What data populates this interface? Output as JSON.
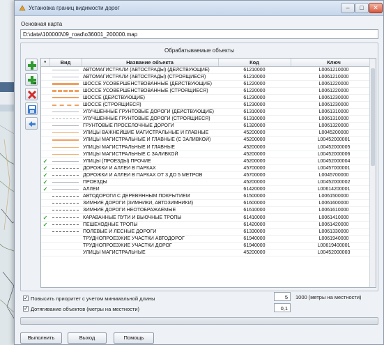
{
  "window": {
    "title": "Установка границ видимости дорог",
    "minimize_glyph": "–",
    "maximize_glyph": "□",
    "close_glyph": "✕"
  },
  "map": {
    "label": "Основная карта",
    "path": "D:\\data\\100000\\09_road\\o36001_200000.map"
  },
  "objects_group": {
    "title": "Обрабатываемые объекты"
  },
  "toolbar": {
    "icons": [
      "add-icon",
      "add-all-icon",
      "delete-icon",
      "save-icon",
      "back-icon"
    ]
  },
  "table": {
    "headers": {
      "check": "*",
      "sample": "Вид",
      "name": "Название объекта",
      "code": "Код",
      "key": "Ключ"
    },
    "rows": [
      {
        "checked": "",
        "style": {
          "color": "#b0b6bd",
          "dash": "solid",
          "width": 1
        },
        "name": "АВТОМАГИСТРАЛИ (АВТОСТРАДЫ) (ДЕЙСТВУЮЩИЕ)",
        "code": "61210000",
        "key": "L0061210000"
      },
      {
        "checked": "",
        "style": {
          "color": "#b0b6bd",
          "dash": "solid",
          "width": 1
        },
        "name": "АВТОМАГИСТРАЛИ (АВТОСТРАДЫ) (СТРОЯЩИЕСЯ)",
        "code": "61210000",
        "key": "L0061210000"
      },
      {
        "checked": "",
        "style": {
          "color": "#f0a060",
          "dash": "solid",
          "width": 3
        },
        "name": "ШОССЕ УСОВЕРШЕНСТВОВАННЫЕ (ДЕЙСТВУЮЩИЕ)",
        "code": "61220000",
        "key": "L0061220000"
      },
      {
        "checked": "",
        "style": {
          "color": "#f0a060",
          "dash": "dashed",
          "width": 3
        },
        "name": "ШОССЕ УСОВЕРШЕНСТВОВАННЫЕ (СТРОЯЩИЕСЯ)",
        "code": "61220000",
        "key": "L0061220000"
      },
      {
        "checked": "",
        "style": {
          "color": "#f0a060",
          "dash": "solid",
          "width": 2
        },
        "name": "ШОССЕ (ДЕЙСТВУЮЩИЕ)",
        "code": "61230000",
        "key": "L0061230000"
      },
      {
        "checked": "",
        "style": {
          "color": "#f0a060",
          "dash": "dashed",
          "width": 2
        },
        "name": "ШОССЕ (СТРОЯЩИЕСЯ)",
        "code": "61230000",
        "key": "L0061230000"
      },
      {
        "checked": "",
        "style": {
          "color": "#b0b6bd",
          "dash": "solid",
          "width": 1
        },
        "name": "УЛУЧШЕННЫЕ ГРУНТОВЫЕ ДОРОГИ (ДЕЙСТВУЮЩИЕ)",
        "code": "61310000",
        "key": "L0061310000"
      },
      {
        "checked": "",
        "style": {
          "color": "#b0b6bd",
          "dash": "dashed",
          "width": 1
        },
        "name": "УЛУЧШЕННЫЕ ГРУНТОВЫЕ ДОРОГИ (СТРОЯЩИЕСЯ)",
        "code": "61310000",
        "key": "L0061310000"
      },
      {
        "checked": "",
        "style": {
          "color": "#9aa0a6",
          "dash": "solid",
          "width": 1
        },
        "name": "ГРУНТОВЫЕ ПРОСЕЛОЧНЫЕ ДОРОГИ",
        "code": "61320000",
        "key": "L0061320000"
      },
      {
        "checked": "",
        "style": {
          "color": "#f0b070",
          "dash": "solid",
          "width": 1
        },
        "name": "УЛИЦЫ ВАЖНЕЙШИЕ МАГИСТРАЛЬНЫЕ И ГЛАВНЫЕ",
        "code": "45200000",
        "key": "L0045200000"
      },
      {
        "checked": "",
        "style": {
          "color": "#f0a060",
          "dash": "solid",
          "width": 2
        },
        "name": "УЛИЦЫ МАГИСТРАЛЬНЫЕ И ГЛАВНЫЕ (С ЗАЛИВКОЙ)",
        "code": "45200000",
        "key": "L00452000001"
      },
      {
        "checked": "",
        "style": {
          "color": "#f0b070",
          "dash": "solid",
          "width": 1
        },
        "name": "УЛИЦЫ МАГИСТРАЛЬНЫЕ И ГЛАВНЫЕ",
        "code": "45200000",
        "key": "L00452000005"
      },
      {
        "checked": "",
        "style": {
          "color": "#f0b070",
          "dash": "solid",
          "width": 1
        },
        "name": "УЛИЦЫ МАГИСТРАЛЬНЫЕ С ЗАЛИВКОЙ",
        "code": "45200000",
        "key": "L00452000006"
      },
      {
        "checked": "✓",
        "style": {
          "color": "#b0b6bd",
          "dash": "solid",
          "width": 1
        },
        "name": "УЛИЦЫ (ПРОЕЗДЫ) ПРОЧИЕ",
        "code": "45200000",
        "key": "L00452000004"
      },
      {
        "checked": "✓",
        "style": {
          "color": "#777",
          "dash": "dashed",
          "width": 1
        },
        "name": "ДОРОЖКИ И АЛЛЕИ В ПАРКАХ",
        "code": "45700000",
        "key": "L00457000001"
      },
      {
        "checked": "✓",
        "style": {
          "color": "#777",
          "dash": "dashed",
          "width": 1
        },
        "name": "ДОРОЖКИ И АЛЛЕИ В ПАРКАХ ОТ 3 ДО 5 МЕТРОВ",
        "code": "45700000",
        "key": "L0045700000"
      },
      {
        "checked": "✓",
        "style": {
          "color": "#b0b6bd",
          "dash": "solid",
          "width": 1
        },
        "name": "ПРОЕЗДЫ",
        "code": "45200000",
        "key": "L00452000002"
      },
      {
        "checked": "✓",
        "style": {
          "color": "#b0b6bd",
          "dash": "solid",
          "width": 1
        },
        "name": "АЛЛЕИ",
        "code": "61420000",
        "key": "L00614200001"
      },
      {
        "checked": "",
        "style": {
          "color": "#555",
          "dash": "dashed",
          "width": 1
        },
        "name": "АВТОДОРОГИ С ДЕРЕВЯННЫМ ПОКРЫТИЕМ",
        "code": "61500000",
        "key": "L0061500000"
      },
      {
        "checked": "",
        "style": {
          "color": "#555",
          "dash": "dashed",
          "width": 1
        },
        "name": "ЗИМНИЕ ДОРОГИ (ЗИМНИКИ, АВТОЗИМНИКИ)",
        "code": "61600000",
        "key": "L0061600000"
      },
      {
        "checked": "",
        "style": {
          "color": "#555",
          "dash": "dashed",
          "width": 1
        },
        "name": "ЗИМНИЕ ДОРОГИ НЕОТОБРАЖАЕМЫЕ",
        "code": "61610000",
        "key": "L0061610000"
      },
      {
        "checked": "✓",
        "style": {
          "color": "#555",
          "dash": "dashed",
          "width": 1
        },
        "name": "КАРАВАННЫЕ ПУТИ И ВЬЮЧНЫЕ ТРОПЫ",
        "code": "61410000",
        "key": "L0061410000"
      },
      {
        "checked": "✓",
        "style": {
          "color": "#555",
          "dash": "dashed",
          "width": 1
        },
        "name": "ПЕШЕХОДНЫЕ ТРОПЫ",
        "code": "61420000",
        "key": "L0061420000"
      },
      {
        "checked": "",
        "style": {
          "color": "#555",
          "dash": "dashed",
          "width": 1
        },
        "name": "ПОЛЕВЫЕ И ЛЕСНЫЕ ДОРОГИ",
        "code": "61330000",
        "key": "L0061330000"
      },
      {
        "checked": "",
        "style": {
          "color": "#ffffff",
          "dash": "solid",
          "width": 1
        },
        "name": "ТРУДНОПРОЕЗЖИЕ УЧАСТКИ АВТОДОРОГ",
        "code": "61940000",
        "key": "L0061940000"
      },
      {
        "checked": "",
        "style": {
          "color": "#ffffff",
          "dash": "solid",
          "width": 1
        },
        "name": "ТРУДНОПРОЕЗЖИЕ УЧАСТКИ ДОРОГ",
        "code": "61940000",
        "key": "L00619400001"
      },
      {
        "checked": "",
        "style": {
          "color": "#ffffff",
          "dash": "solid",
          "width": 1
        },
        "name": "УЛИЦЫ МАГИСТРАЛЬНЫЕ",
        "code": "45200000",
        "key": "L00452000003"
      }
    ]
  },
  "options": {
    "priority_label": "Повысить приоритет с учетом минимальной длины",
    "priority_checked": true,
    "priority_value": "5",
    "priority_note": "1000 (метры на местности)",
    "extend_label": "Дотягивание объектов (метры на местности)",
    "extend_checked": true,
    "extend_value": "0,1"
  },
  "buttons": {
    "run": "Выполнить",
    "exit": "Выход",
    "help": "Помощь"
  }
}
